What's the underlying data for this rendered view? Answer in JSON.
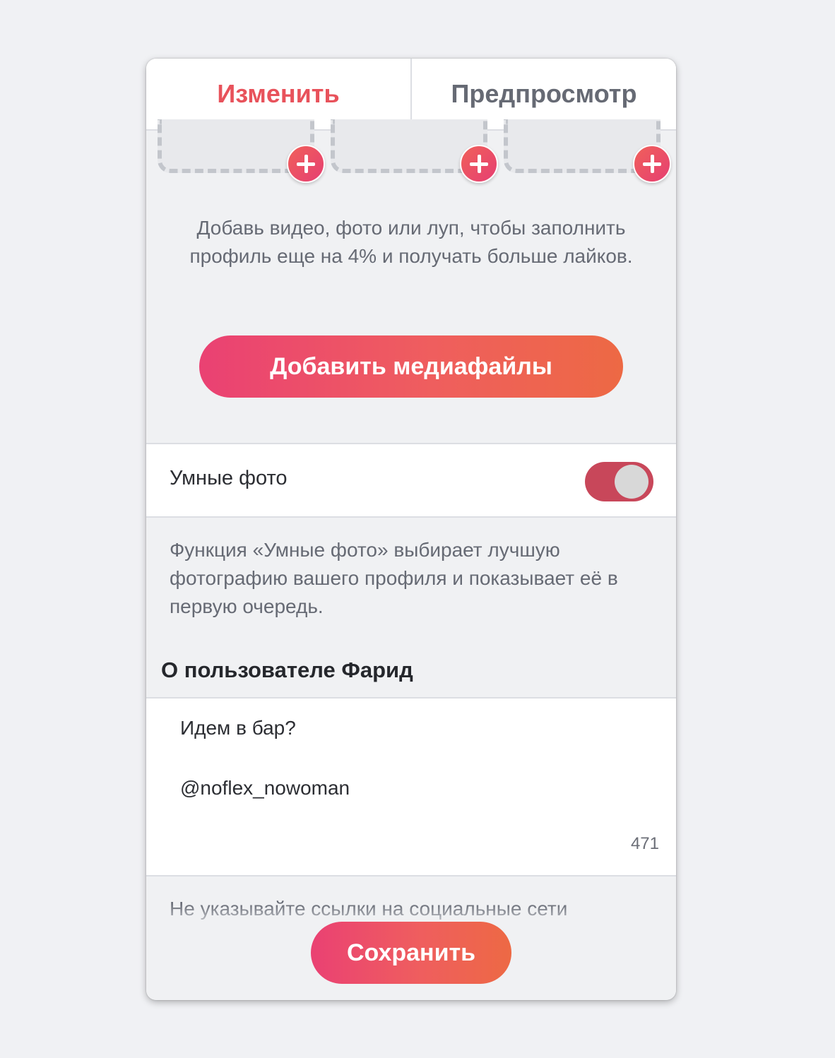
{
  "tabs": {
    "edit_label": "Изменить",
    "preview_label": "Предпросмотр",
    "active": "edit"
  },
  "media": {
    "hint": "Добавь видео, фото или луп, чтобы заполнить профиль еще на 4% и получать больше лайков.",
    "add_button_label": "Добавить медиафайлы",
    "slot_icon": "plus-icon"
  },
  "smart_photos": {
    "label": "Умные фото",
    "enabled": true,
    "description": "Функция «Умные фото» выбирает лучшую фотографию вашего профиля и показывает её в первую очередь."
  },
  "about": {
    "title": "О пользователе Фарид",
    "lines": [
      "Идем в бар?",
      "@noflex_nowoman"
    ],
    "remaining_chars": "471",
    "hint": "Не указывайте ссылки на социальные сети"
  },
  "footer": {
    "save_label": "Сохранить"
  },
  "colors": {
    "accent": "#e8525b",
    "gradient_start": "#ea4173",
    "gradient_end": "#ed6944",
    "toggle_on": "#c8475a"
  }
}
